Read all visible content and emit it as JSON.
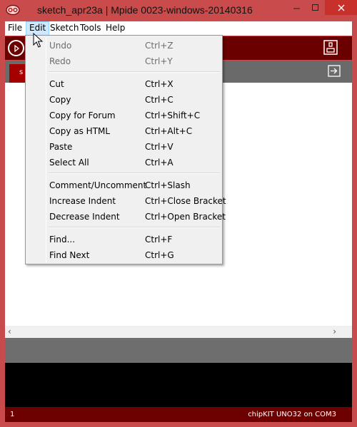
{
  "window": {
    "title": "sketch_apr23a | Mpide 0023-windows-20140316",
    "frame_color": "#c94b4b",
    "close_color": "#c7302b"
  },
  "menubar": {
    "items": [
      {
        "label": "File"
      },
      {
        "label": "Edit"
      },
      {
        "label": "Sketch"
      },
      {
        "label": "Tools"
      },
      {
        "label": "Help"
      }
    ]
  },
  "toolbar": {
    "accent": "#6b0000",
    "verify_icon": "play-circle-icon",
    "serial_icon": "serial-monitor-icon"
  },
  "tabs": {
    "active_tab": "s",
    "tab_color": "#a40000",
    "menu_icon": "tab-arrow-icon"
  },
  "edit_menu": {
    "groups": [
      [
        {
          "label": "Undo",
          "shortcut": "Ctrl+Z",
          "enabled": false
        },
        {
          "label": "Redo",
          "shortcut": "Ctrl+Y",
          "enabled": false
        }
      ],
      [
        {
          "label": "Cut",
          "shortcut": "Ctrl+X",
          "enabled": true
        },
        {
          "label": "Copy",
          "shortcut": "Ctrl+C",
          "enabled": true
        },
        {
          "label": "Copy for Forum",
          "shortcut": "Ctrl+Shift+C",
          "enabled": true
        },
        {
          "label": "Copy as HTML",
          "shortcut": "Ctrl+Alt+C",
          "enabled": true
        },
        {
          "label": "Paste",
          "shortcut": "Ctrl+V",
          "enabled": true
        },
        {
          "label": "Select All",
          "shortcut": "Ctrl+A",
          "enabled": true
        }
      ],
      [
        {
          "label": "Comment/Uncomment",
          "shortcut": "Ctrl+Slash",
          "enabled": true
        },
        {
          "label": "Increase Indent",
          "shortcut": "Ctrl+Close Bracket",
          "enabled": true
        },
        {
          "label": "Decrease Indent",
          "shortcut": "Ctrl+Open Bracket",
          "enabled": true
        }
      ],
      [
        {
          "label": "Find...",
          "shortcut": "Ctrl+F",
          "enabled": true
        },
        {
          "label": "Find Next",
          "shortcut": "Ctrl+G",
          "enabled": true
        }
      ]
    ]
  },
  "footer": {
    "line_number": "1",
    "board": "chipKIT UNO32 on COM3"
  }
}
